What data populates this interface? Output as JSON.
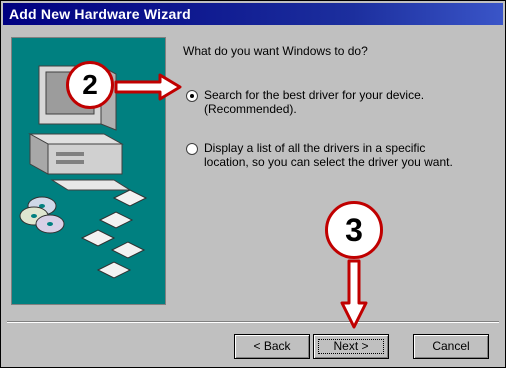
{
  "window": {
    "title": "Add New Hardware Wizard"
  },
  "prompt": "What do you want Windows to do?",
  "options": [
    {
      "line1": "Search for the best driver for your device.",
      "line2": "(Recommended).",
      "selected": true
    },
    {
      "line1": "Display a list of all the drivers in a specific",
      "line2": "location, so you can select the driver you want.",
      "selected": false
    }
  ],
  "buttons": {
    "back": "< Back",
    "next": "Next >",
    "cancel": "Cancel"
  },
  "annotations": {
    "step2": "2",
    "step3": "3"
  },
  "colors": {
    "title_bar": "#000080",
    "panel": "#008080",
    "annotation": "#c00000"
  },
  "icons": [
    "computer-icon",
    "cd-icon",
    "disk-icon",
    "right-arrow-icon",
    "down-arrow-icon"
  ]
}
